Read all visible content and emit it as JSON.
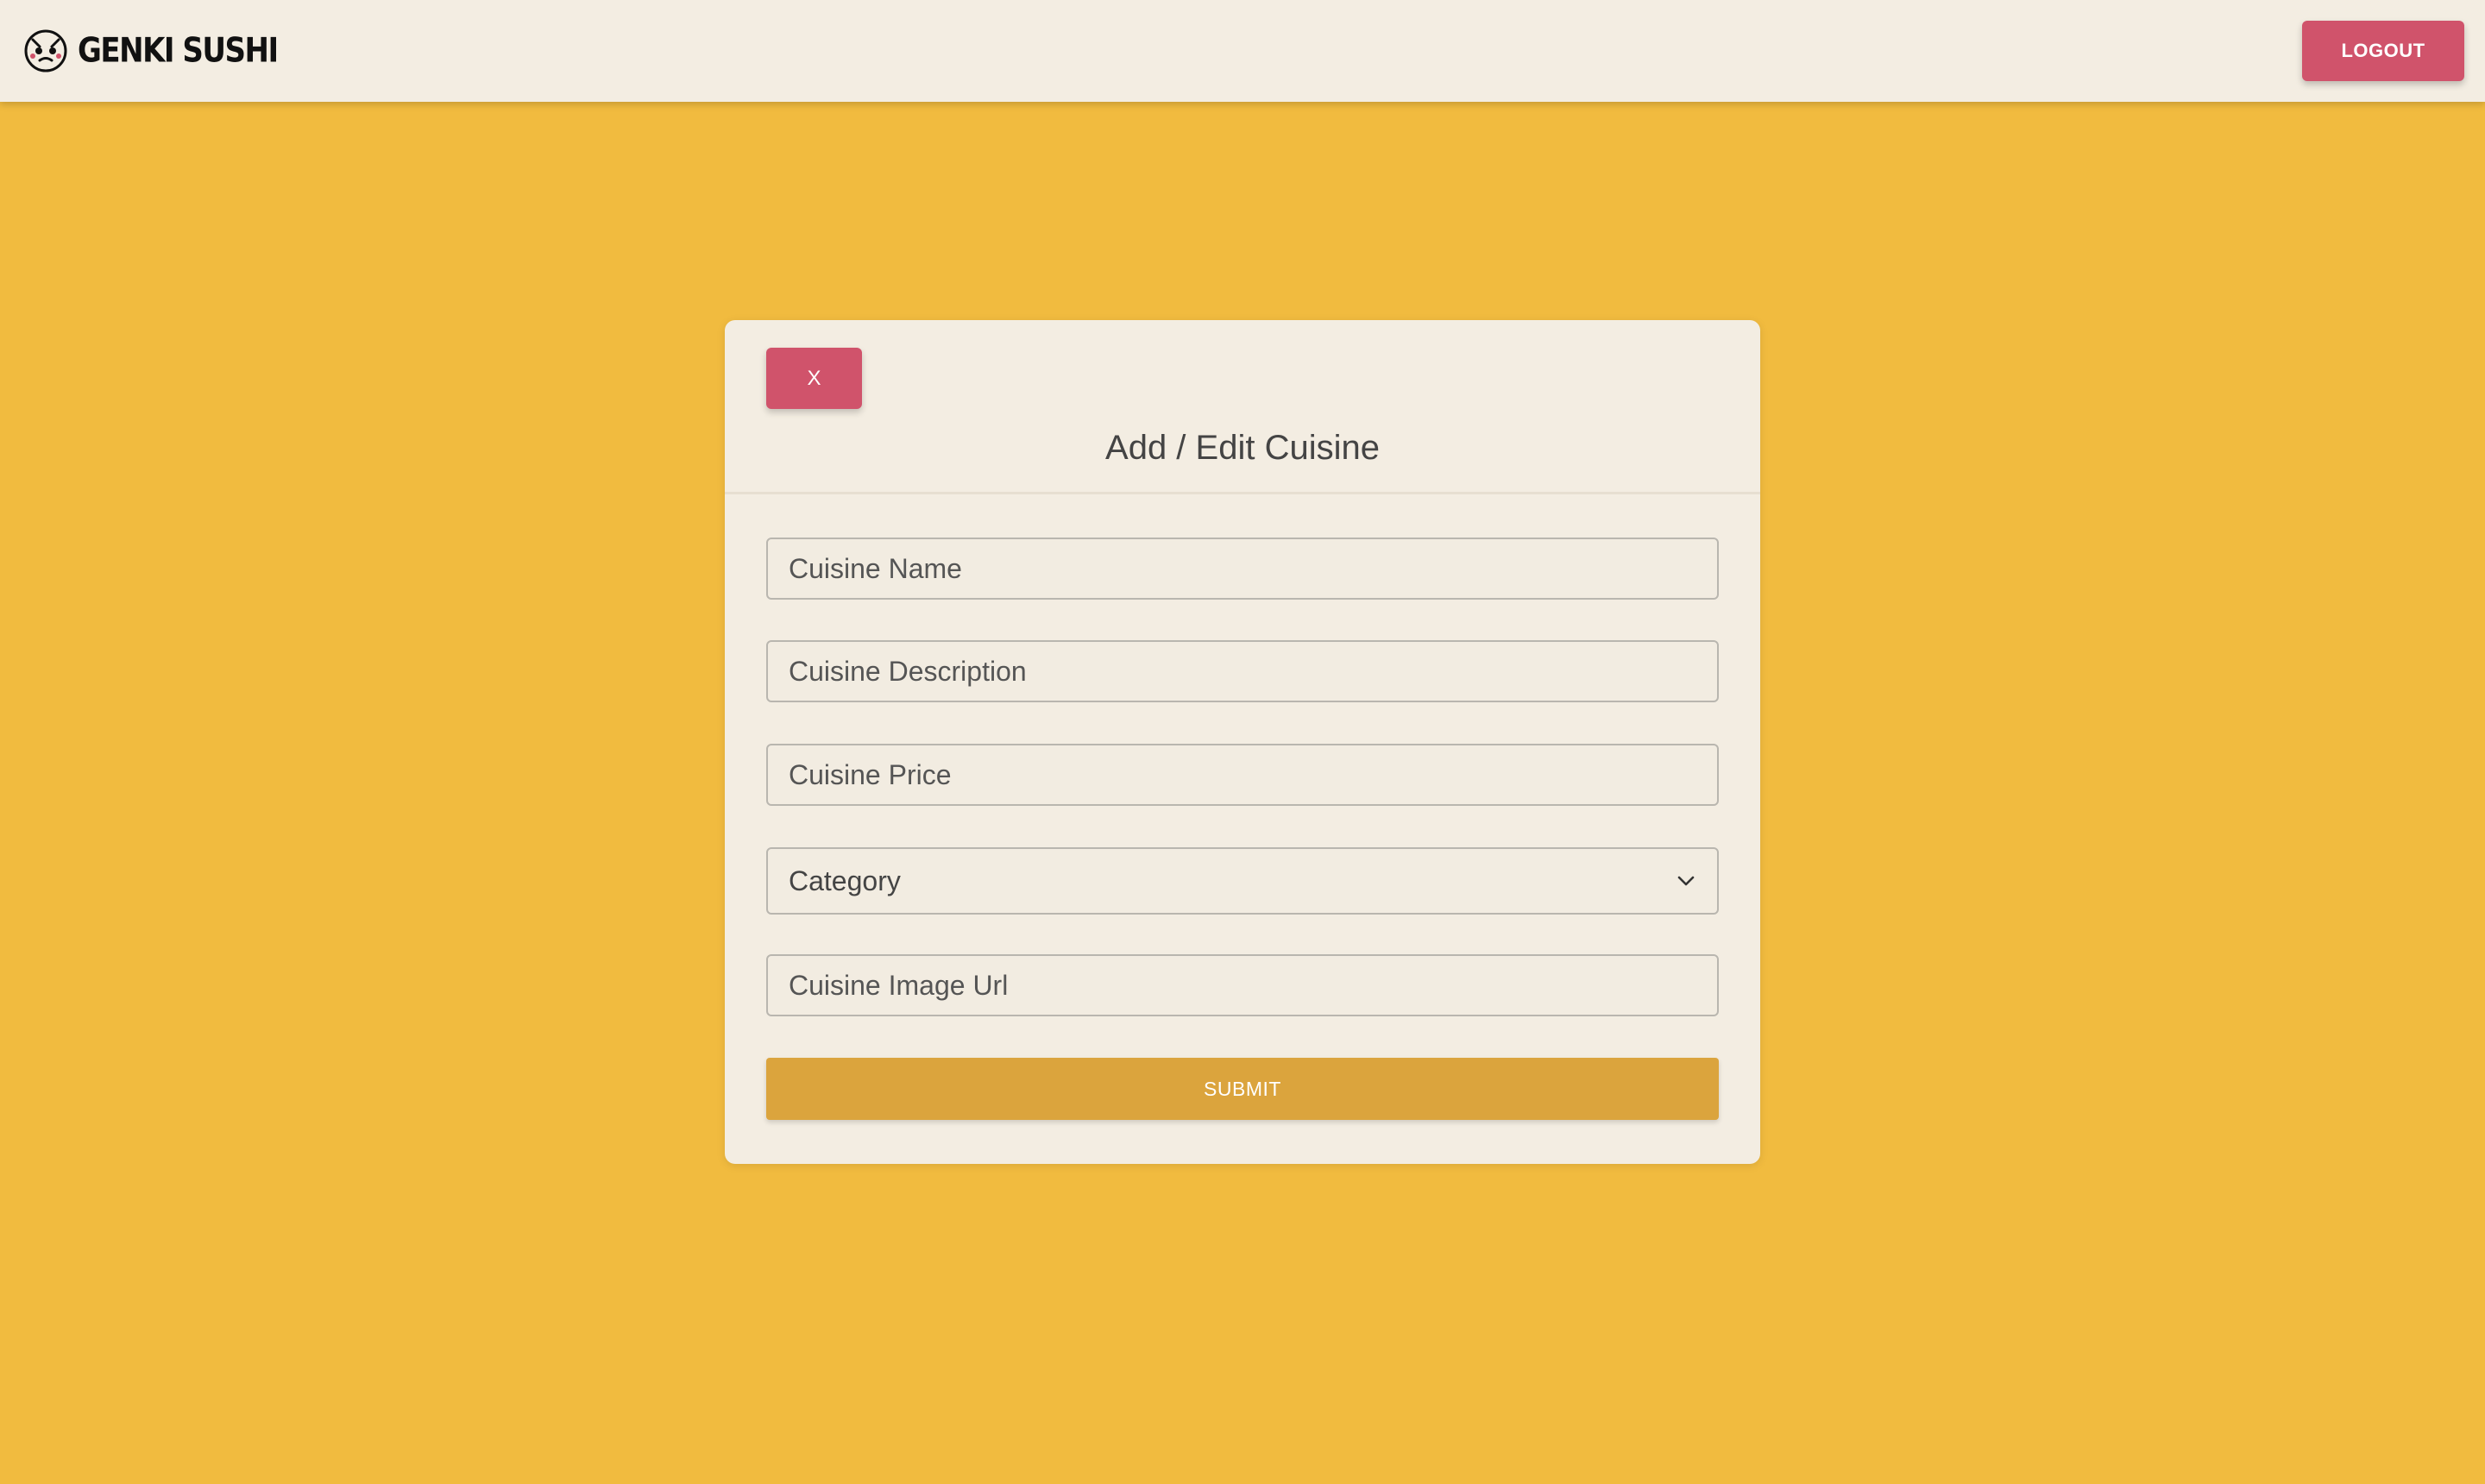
{
  "header": {
    "brand_name": "GENKI SUSHI",
    "logout_label": "LOGOUT"
  },
  "modal": {
    "close_label": "X",
    "title": "Add / Edit Cuisine",
    "fields": {
      "name_placeholder": "Cuisine Name",
      "description_placeholder": "Cuisine Description",
      "price_placeholder": "Cuisine Price",
      "category_selected": "Category",
      "image_url_placeholder": "Cuisine Image Url"
    },
    "submit_label": "SUBMIT"
  },
  "icons": {
    "logo": "genki-sushi-logo-icon",
    "select_arrow": "chevron-down-icon"
  },
  "colors": {
    "page_background": "#f1bb3f",
    "surface": "#f3ede2",
    "accent_red": "#d0536b",
    "submit_gold": "#dba43d"
  }
}
